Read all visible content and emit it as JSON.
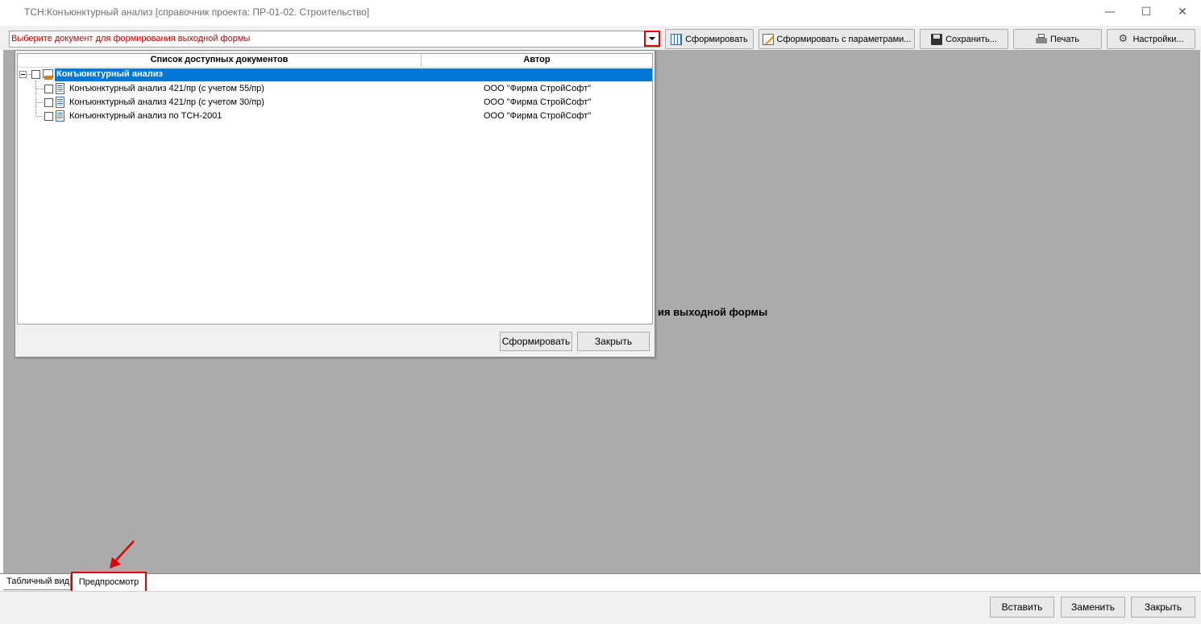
{
  "window": {
    "title": "ТСН:Конъюнктурный анализ [справочник проекта: ПР-01-02. Строительство]"
  },
  "toolbar": {
    "combo_text": "Выберите документ для формирования выходной формы",
    "generate_label": "Сформировать",
    "generate_params_label": "Сформировать с параметрами...",
    "save_label": "Сохранить...",
    "print_label": "Печать",
    "settings_label": "Настройки..."
  },
  "main": {
    "placeholder_visible": "ия выходной формы"
  },
  "popup": {
    "columns": [
      "Список доступных документов",
      "Автор"
    ],
    "tree": {
      "root_label": "Конъюнктурный анализ",
      "items": [
        {
          "label": "Конъюнктурный анализ 421/пр (с учетом 55/пр)",
          "author": "ООО \"Фирма СтройСофт\""
        },
        {
          "label": "Конъюнктурный анализ 421/пр (с учетом 30/пр)",
          "author": "ООО \"Фирма СтройСофт\""
        },
        {
          "label": "Конъюнктурный анализ по ТСН-2001",
          "author": "ООО \"Фирма СтройСофт\""
        }
      ]
    },
    "generate_label": "Сформировать",
    "close_label": "Закрыть"
  },
  "tabs": [
    "Табличный вид",
    "Предпросмотр"
  ],
  "bottom": {
    "insert_label": "Вставить",
    "replace_label": "Заменить",
    "close_label": "Закрыть"
  },
  "colors": {
    "highlight": "#e00000",
    "selection": "#0078d7",
    "workspace": "#ababab"
  }
}
